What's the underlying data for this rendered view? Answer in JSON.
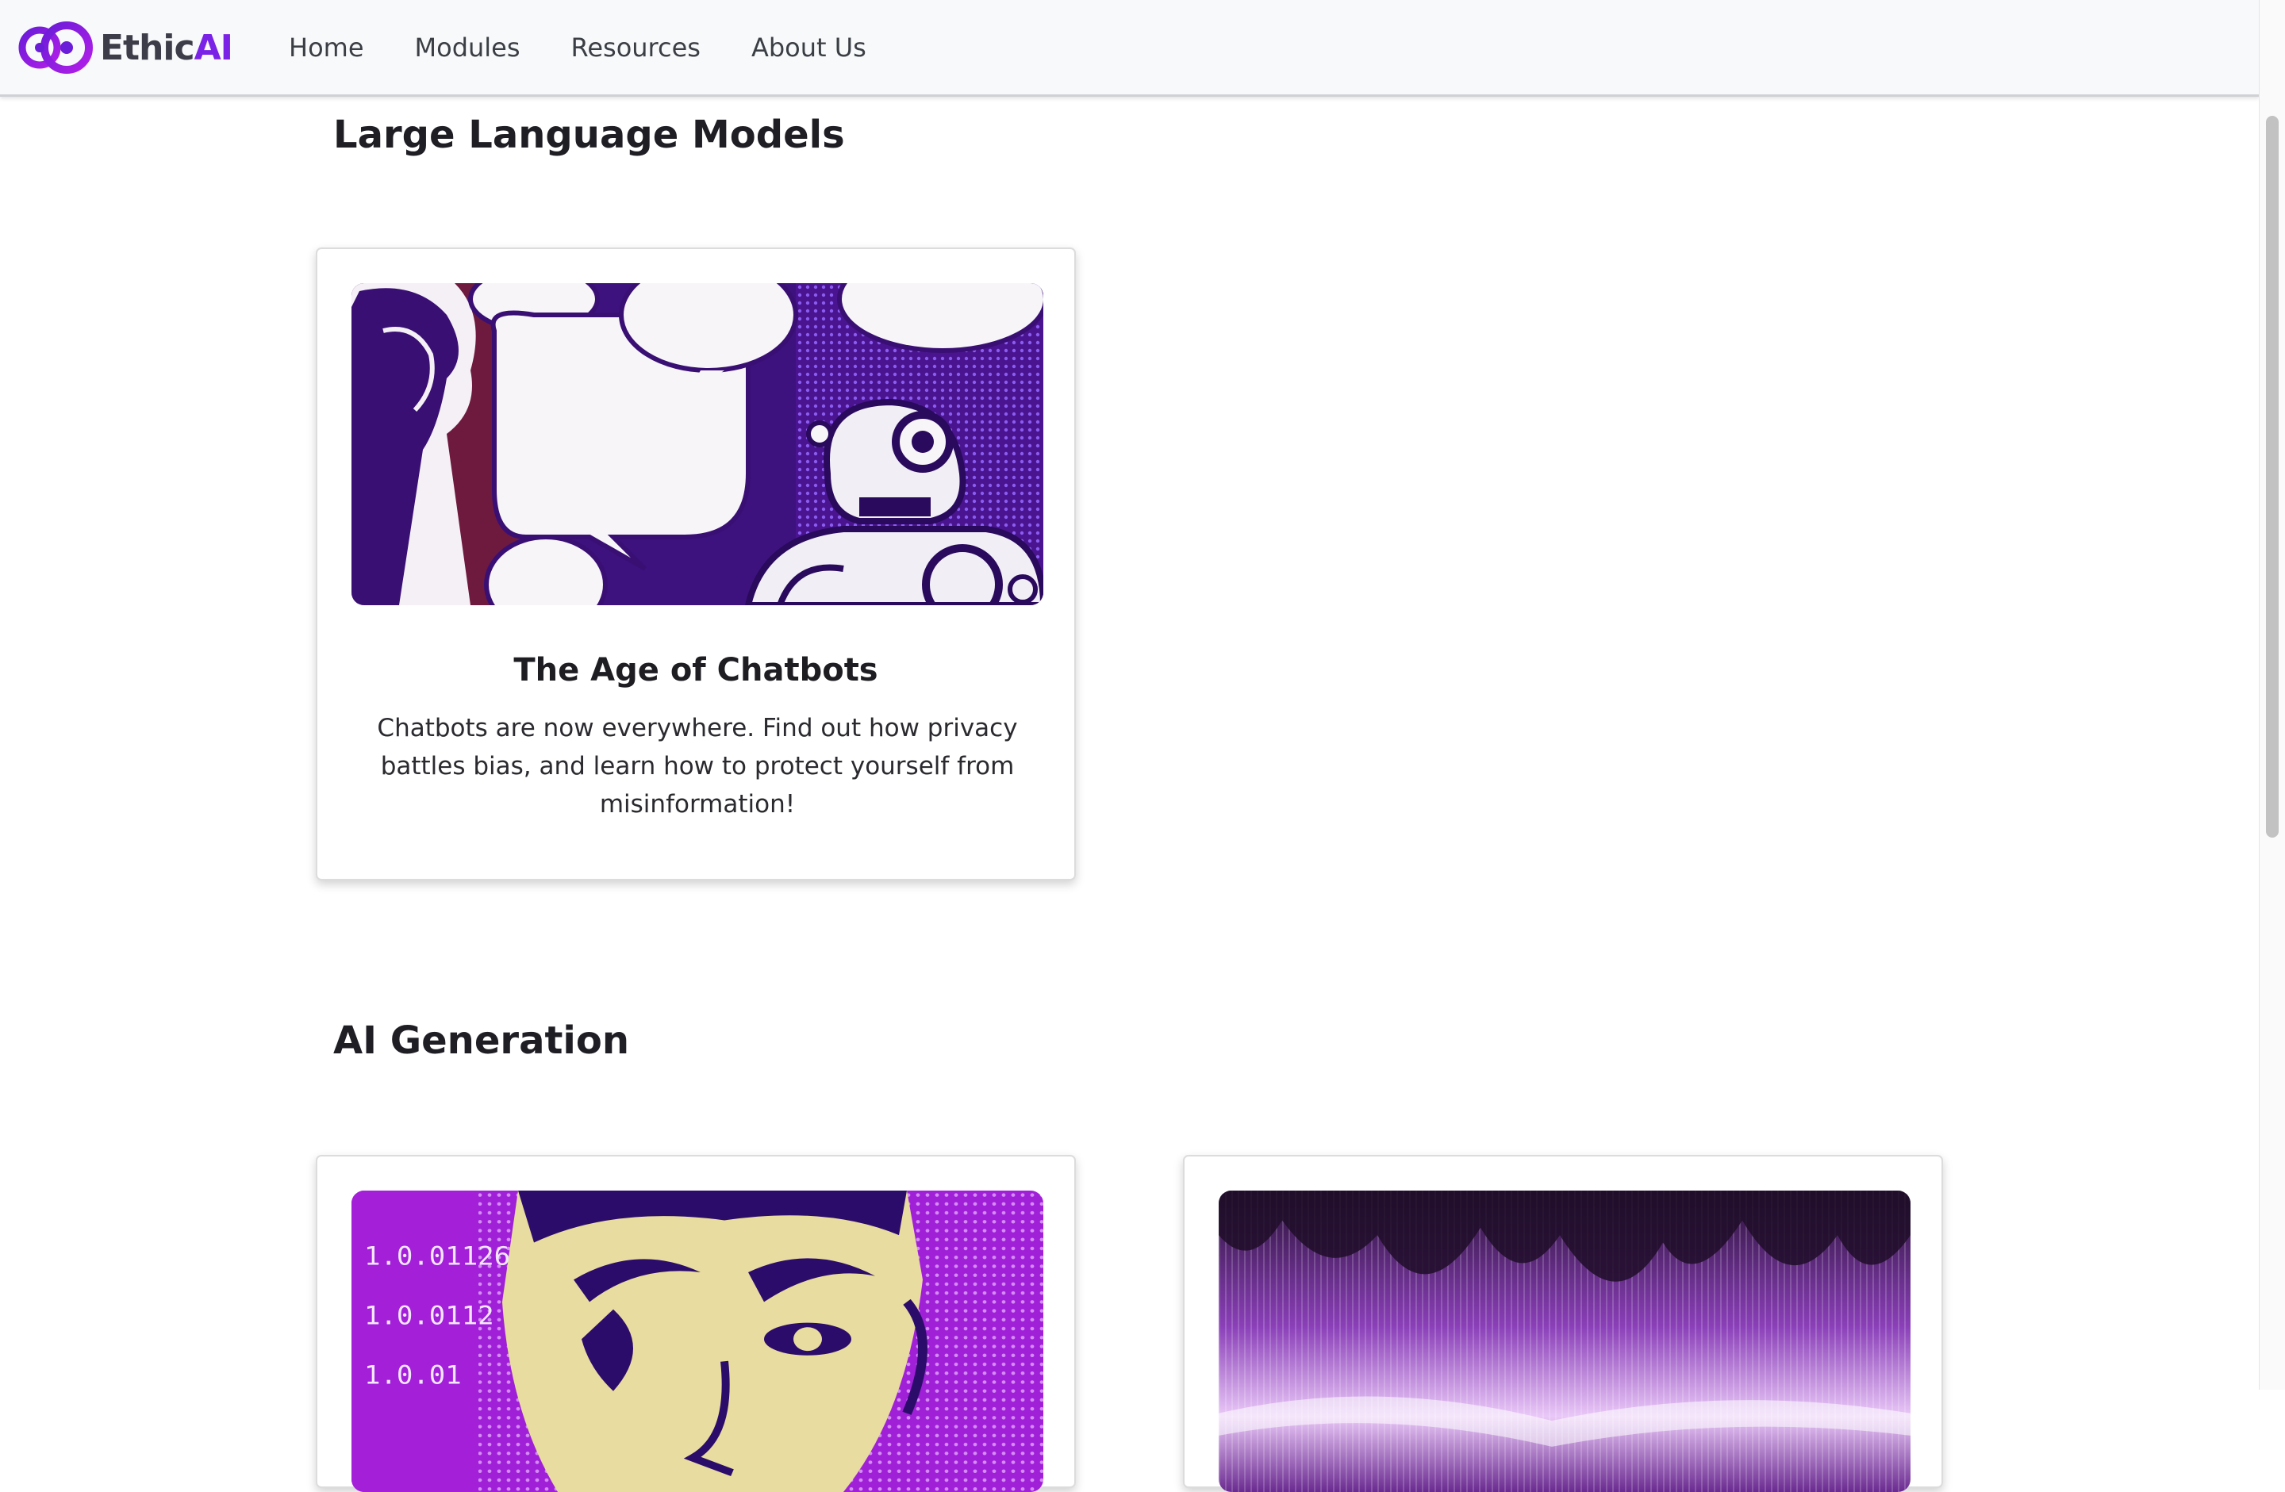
{
  "nav": {
    "brand": {
      "part1": "Ethic",
      "part2": "AI",
      "icon": "infinity-logo-icon"
    },
    "links": [
      "Home",
      "Modules",
      "Resources",
      "About Us"
    ]
  },
  "sections": [
    {
      "title": "Large Language Models",
      "cards": [
        {
          "title": "The Age of Chatbots",
          "description": "Chatbots are now everywhere. Find out how privacy battles bias, and learn how to protect yourself from misinformation!",
          "image": "comic-chatbot-illustration"
        }
      ]
    },
    {
      "title": "AI Generation",
      "cards": [
        {
          "title": "",
          "description": "",
          "image": "purple-face-binary-illustration"
        },
        {
          "title": "",
          "description": "",
          "image": "purple-soundwave-illustration"
        }
      ]
    }
  ],
  "colors": {
    "brand_purple": "#7a22e6",
    "nav_bg": "#f8f9fa",
    "accent_violet": "#5a1fa8"
  }
}
